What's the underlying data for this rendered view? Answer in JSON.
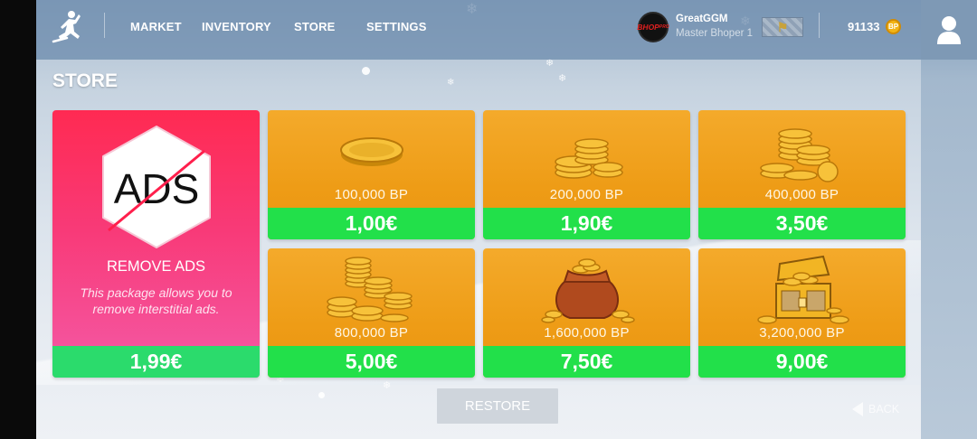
{
  "nav": {
    "items": [
      "MARKET",
      "INVENTORY",
      "STORE",
      "SETTINGS"
    ]
  },
  "user": {
    "badge_text": "BHOP",
    "badge_sub": "PRO",
    "name": "GreatGGM",
    "rank": "Master Bhoper 1",
    "balance": "91133",
    "currency_icon_text": "BP"
  },
  "page": {
    "title": "STORE"
  },
  "ads_offer": {
    "logo_text": "ADS",
    "title": "REMOVE ADS",
    "description": "This package allows you to remove interstitial ads.",
    "price": "1,99€"
  },
  "coin_packs": [
    {
      "icon": "single-coin-icon",
      "amount": "100,000 BP",
      "price": "1,00€"
    },
    {
      "icon": "coin-stack-small-icon",
      "amount": "200,000 BP",
      "price": "1,90€"
    },
    {
      "icon": "coin-stack-medium-icon",
      "amount": "400,000 BP",
      "price": "3,50€"
    },
    {
      "icon": "coin-pile-icon",
      "amount": "800,000 BP",
      "price": "5,00€"
    },
    {
      "icon": "coin-bag-icon",
      "amount": "1,600,000 BP",
      "price": "7,50€"
    },
    {
      "icon": "treasure-chest-icon",
      "amount": "3,200,000 BP",
      "price": "9,00€"
    }
  ],
  "actions": {
    "restore": "RESTORE",
    "back": "BACK"
  },
  "colors": {
    "card_orange": "#ee9c16",
    "price_green": "#22e04a",
    "ads_pink": "#f83a78",
    "topbar": "#6888aa"
  }
}
